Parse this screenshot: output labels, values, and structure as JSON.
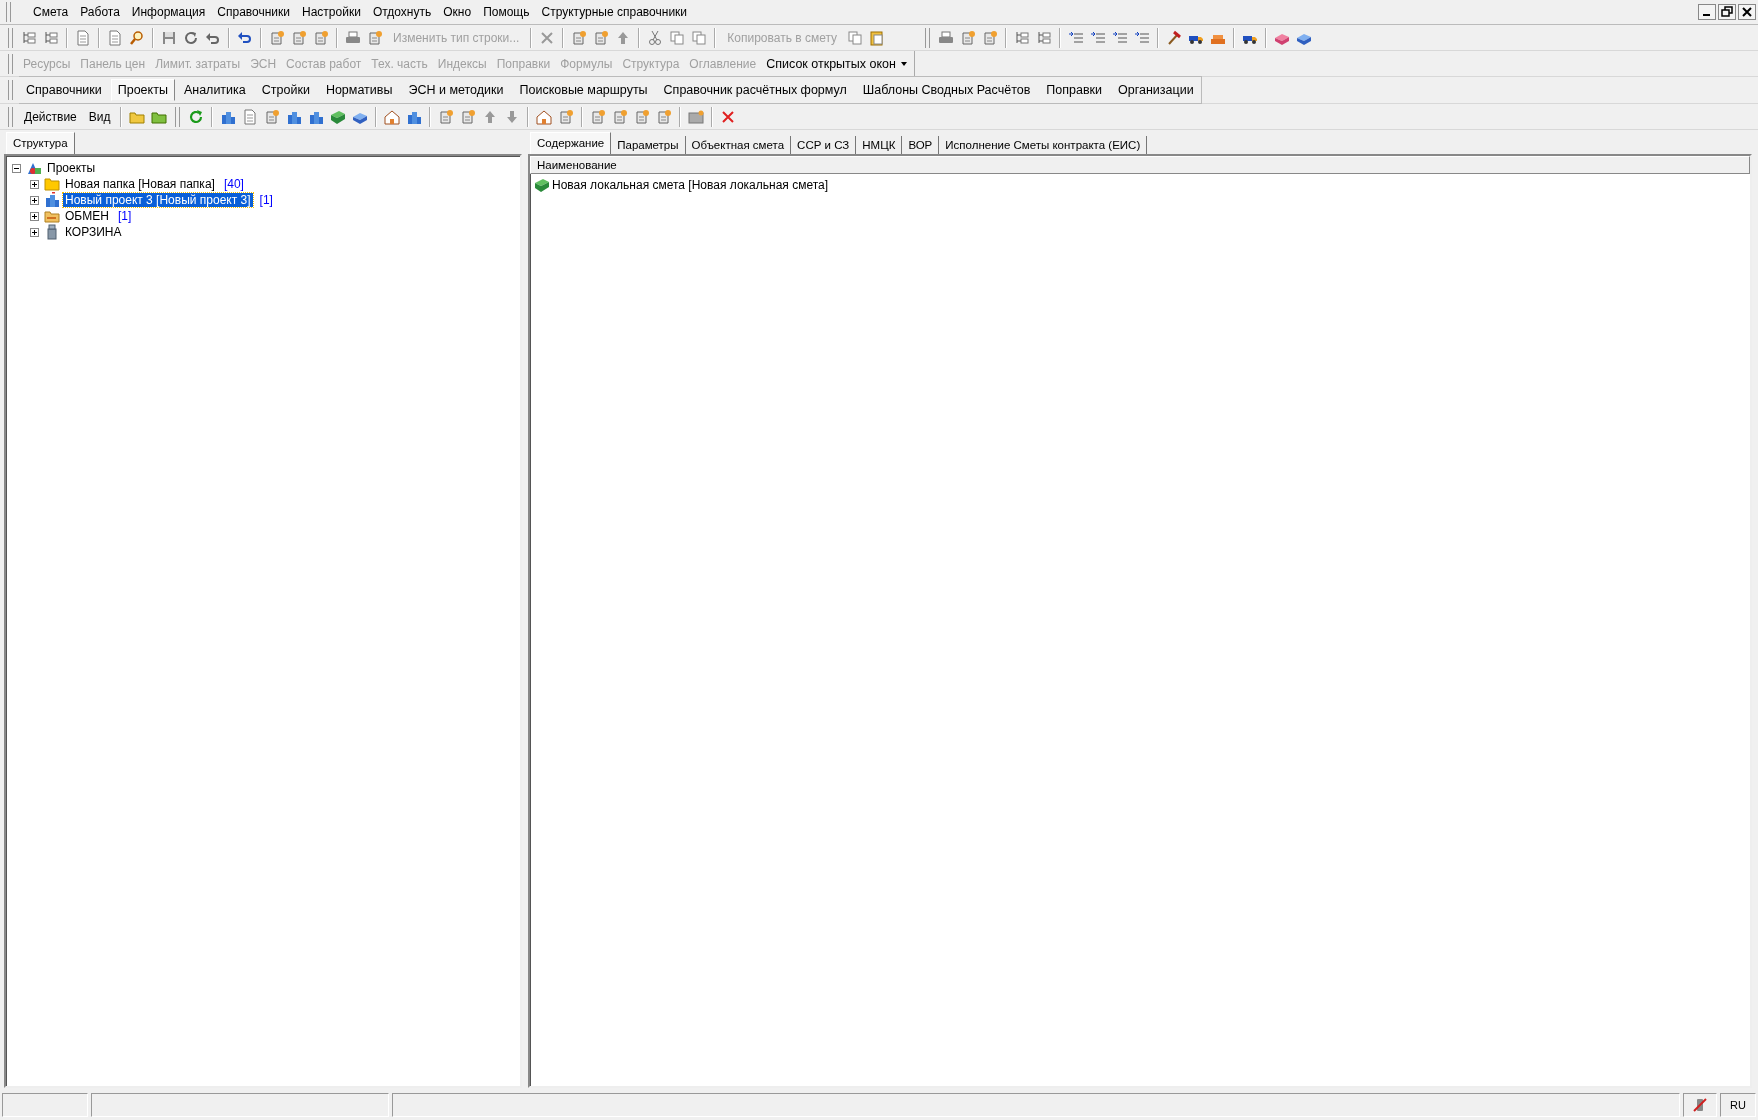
{
  "menu": {
    "items": [
      "Смета",
      "Работа",
      "Информация",
      "Справочники",
      "Настройки",
      "Отдохнуть",
      "Окно",
      "Помощь",
      "Структурные справочники"
    ]
  },
  "toolbar": {
    "buttons": [
      {
        "label": "Изменить тип строки...",
        "disabled": true
      },
      {
        "label": "Копировать в смету",
        "disabled": true
      }
    ]
  },
  "panel_bar": {
    "items": [
      {
        "label": "Ресурсы",
        "disabled": true
      },
      {
        "label": "Панель цен",
        "disabled": true
      },
      {
        "label": "Лимит. затраты",
        "disabled": true
      },
      {
        "label": "ЭСН",
        "disabled": true
      },
      {
        "label": "Состав работ",
        "disabled": true
      },
      {
        "label": "Тех. часть",
        "disabled": true
      },
      {
        "label": "Индексы",
        "disabled": true
      },
      {
        "label": "Поправки",
        "disabled": true
      },
      {
        "label": "Формулы",
        "disabled": true
      },
      {
        "label": "Структура",
        "disabled": true
      },
      {
        "label": "Оглавление",
        "disabled": true
      }
    ],
    "dropdown": {
      "label": "Список открытых окон"
    }
  },
  "nav_tabs": [
    {
      "label": "Справочники",
      "selected": false
    },
    {
      "label": "Проекты",
      "selected": true
    },
    {
      "label": "Аналитика",
      "selected": false
    },
    {
      "label": "Стройки",
      "selected": false
    },
    {
      "label": "Нормативы",
      "selected": false
    },
    {
      "label": "ЭСН и методики",
      "selected": false
    },
    {
      "label": "Поисковые маршруты",
      "selected": false
    },
    {
      "label": "Справочник расчётных формул",
      "selected": false
    },
    {
      "label": "Шаблоны Сводных Расчётов",
      "selected": false
    },
    {
      "label": "Поправки",
      "selected": false
    },
    {
      "label": "Организации",
      "selected": false
    }
  ],
  "action_bar": {
    "menus": [
      "Действие",
      "Вид"
    ]
  },
  "structure_panel": {
    "tabs": [
      {
        "label": "Структура",
        "selected": true
      }
    ],
    "tree": {
      "kind": "projects",
      "label": "Проекты",
      "expanded": true,
      "selected": false,
      "children": [
        {
          "kind": "folder",
          "label": "Новая папка [Новая папка]",
          "count": "[40]",
          "expanded": false,
          "selected": false
        },
        {
          "kind": "project",
          "label": "Новый проект 3 [Новый проект 3]",
          "count": "[1]",
          "expanded": false,
          "selected": true
        },
        {
          "kind": "exchange",
          "label": "ОБМЕН",
          "count": "[1]",
          "expanded": false,
          "selected": false
        },
        {
          "kind": "trash",
          "label": "КОРЗИНА",
          "expanded": false,
          "selected": false
        }
      ]
    }
  },
  "content_panel": {
    "tabs": [
      {
        "label": "Содержание",
        "selected": true
      },
      {
        "label": "Параметры",
        "selected": false
      },
      {
        "label": "Объектная смета",
        "selected": false
      },
      {
        "label": "ССР и СЗ",
        "selected": false
      },
      {
        "label": "НМЦК",
        "selected": false
      },
      {
        "label": "ВОР",
        "selected": false
      },
      {
        "label": "Исполнение Сметы контракта (ЕИС)",
        "selected": false
      }
    ],
    "table": {
      "columns": [
        "Наименование"
      ],
      "rows": [
        {
          "name": "Новая локальная смета [Новая локальная смета]"
        }
      ]
    }
  },
  "status_bar": {
    "language": "RU"
  }
}
